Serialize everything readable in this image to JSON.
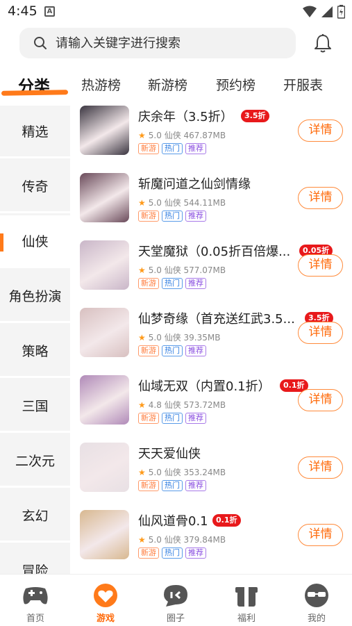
{
  "status_bar": {
    "time": "4:45",
    "notification_glyph": "A"
  },
  "search": {
    "placeholder": "请输入关键字进行搜索"
  },
  "tabs": [
    {
      "label": "分类",
      "active": true
    },
    {
      "label": "热游榜"
    },
    {
      "label": "新游榜"
    },
    {
      "label": "预约榜"
    },
    {
      "label": "开服表"
    }
  ],
  "categories": [
    {
      "label": "精选"
    },
    {
      "label": "传奇"
    },
    {
      "label": "仙侠",
      "active": true
    },
    {
      "label": "角色扮演"
    },
    {
      "label": "策略"
    },
    {
      "label": "三国"
    },
    {
      "label": "二次元"
    },
    {
      "label": "玄幻"
    },
    {
      "label": "冒险"
    }
  ],
  "games": [
    {
      "name": "庆余年（3.5折）",
      "discount": "3.5折",
      "rating": "5.0",
      "genre": "仙侠",
      "size": "467.87MB",
      "tags": [
        "新游",
        "热门",
        "推荐"
      ],
      "detail_label": "详情"
    },
    {
      "name": "斩魔问道之仙剑情缘",
      "discount": "",
      "rating": "5.0",
      "genre": "仙侠",
      "size": "544.11MB",
      "tags": [
        "新游",
        "热门",
        "推荐"
      ],
      "detail_label": "详情"
    },
    {
      "name": "天堂魔狱（0.05折百倍爆...",
      "discount": "0.05折",
      "rating": "5.0",
      "genre": "仙侠",
      "size": "577.07MB",
      "tags": [
        "新游",
        "热门",
        "推荐"
      ],
      "detail_label": "详情"
    },
    {
      "name": "仙梦奇缘（首充送红武3.5...",
      "discount": "3.5折",
      "rating": "5.0",
      "genre": "仙侠",
      "size": "39.35MB",
      "tags": [
        "新游",
        "热门",
        "推荐"
      ],
      "detail_label": "详情"
    },
    {
      "name": "仙域无双（内置0.1折）",
      "discount": "0.1折",
      "rating": "4.8",
      "genre": "仙侠",
      "size": "573.72MB",
      "tags": [
        "新游",
        "热门",
        "推荐"
      ],
      "detail_label": "详情"
    },
    {
      "name": "天天爱仙侠",
      "discount": "",
      "rating": "5.0",
      "genre": "仙侠",
      "size": "353.24MB",
      "tags": [
        "新游",
        "热门",
        "推荐"
      ],
      "detail_label": "详情"
    },
    {
      "name": "仙风道骨0.1",
      "discount": "0.1折",
      "rating": "5.0",
      "genre": "仙侠",
      "size": "379.84MB",
      "tags": [
        "新游",
        "热门",
        "推荐"
      ],
      "detail_label": "详情"
    }
  ],
  "thumb_colors": [
    "#3a3540",
    "#6a4a5a",
    "#c9b6c8",
    "#d8c0c0",
    "#b08ab8",
    "#e8e0e4",
    "#d8b890"
  ],
  "bottom_nav": [
    {
      "label": "首页",
      "icon": "gamepad-icon"
    },
    {
      "label": "游戏",
      "icon": "game-heart-icon",
      "active": true
    },
    {
      "label": "圈子",
      "icon": "chat-bubble-icon"
    },
    {
      "label": "福利",
      "icon": "gift-icon"
    },
    {
      "label": "我的",
      "icon": "profile-sunglasses-icon"
    }
  ],
  "colors": {
    "accent": "#ff7a1a",
    "discount_badge": "#e8191b"
  }
}
